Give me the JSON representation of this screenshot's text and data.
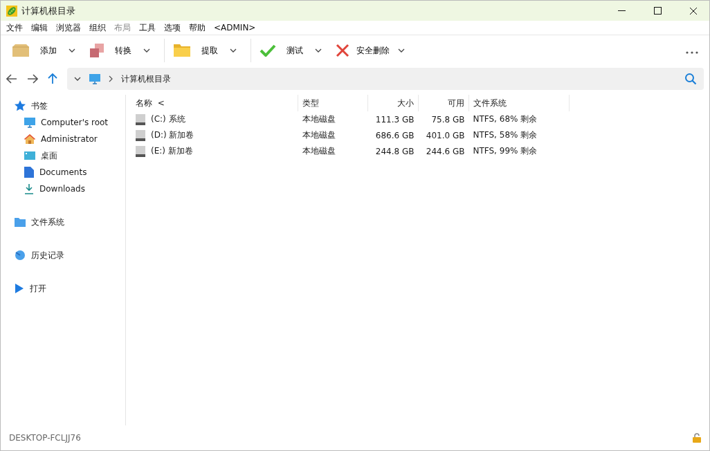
{
  "window": {
    "title": "计算机根目录"
  },
  "menu": [
    {
      "label": "文件",
      "disabled": false
    },
    {
      "label": "编辑",
      "disabled": false
    },
    {
      "label": "浏览器",
      "disabled": false
    },
    {
      "label": "组织",
      "disabled": false
    },
    {
      "label": "布局",
      "disabled": true
    },
    {
      "label": "工具",
      "disabled": false
    },
    {
      "label": "选项",
      "disabled": false
    },
    {
      "label": "帮助",
      "disabled": false
    },
    {
      "label": "<ADMIN>",
      "disabled": false
    }
  ],
  "toolbar": [
    {
      "kind": "add",
      "label": "添加"
    },
    {
      "kind": "convert",
      "label": "转换"
    },
    {
      "kind": "extract",
      "label": "提取"
    },
    {
      "kind": "test",
      "label": "测试"
    },
    {
      "kind": "delete",
      "label": "安全删除"
    }
  ],
  "address": {
    "path": "计算机根目录"
  },
  "sidebar": [
    {
      "kind": "star",
      "label": "书签",
      "children": [
        {
          "kind": "monitor",
          "label": "Computer's root"
        },
        {
          "kind": "home",
          "label": "Administrator"
        },
        {
          "kind": "desktop",
          "label": "桌面"
        },
        {
          "kind": "document",
          "label": "Documents"
        },
        {
          "kind": "download",
          "label": "Downloads"
        }
      ]
    },
    {
      "kind": "folder",
      "label": "文件系统"
    },
    {
      "kind": "history",
      "label": "历史记录"
    },
    {
      "kind": "play",
      "label": "打开"
    }
  ],
  "table": {
    "columns": [
      {
        "label": "名称",
        "sort": "<"
      },
      {
        "label": "类型"
      },
      {
        "label": "大小"
      },
      {
        "label": "可用"
      },
      {
        "label": "文件系统"
      }
    ],
    "rows": [
      [
        "(C:) 系统",
        "本地磁盘",
        "111.3 GB",
        "75.8 GB",
        "NTFS, 68% 剩余"
      ],
      [
        "(D:) 新加卷",
        "本地磁盘",
        "686.6 GB",
        "401.0 GB",
        "NTFS, 58% 剩余"
      ],
      [
        "(E:) 新加卷",
        "本地磁盘",
        "244.8 GB",
        "244.6 GB",
        "NTFS, 99% 剩余"
      ]
    ]
  },
  "status_bar": {
    "text": "DESKTOP-FCLJJ76"
  }
}
